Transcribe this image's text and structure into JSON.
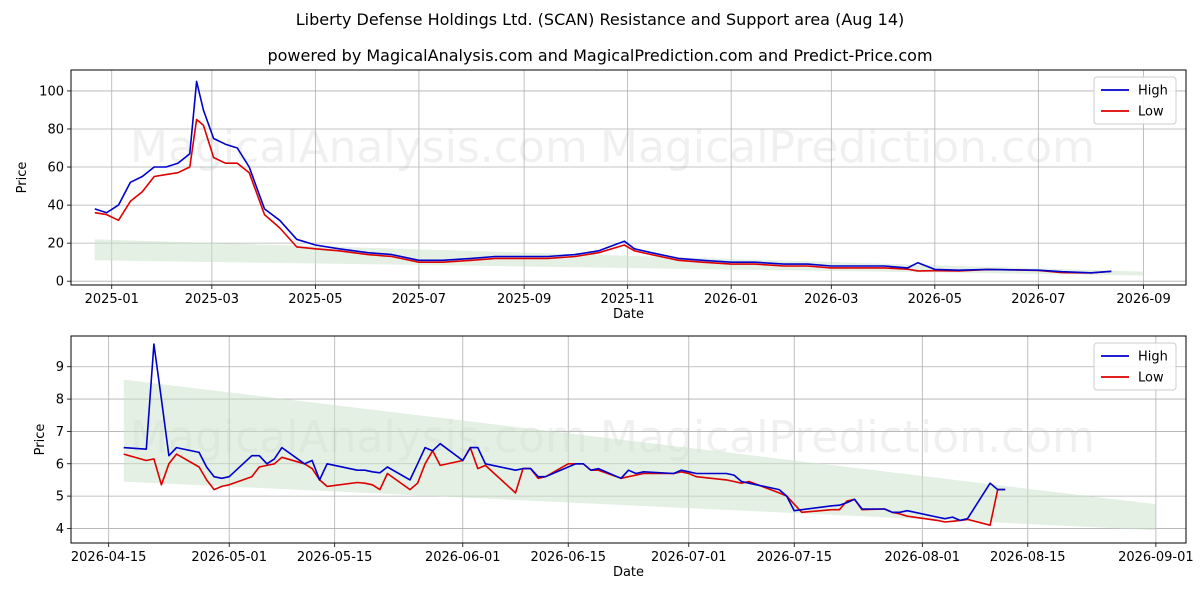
{
  "header": {
    "title": "Liberty Defense Holdings Ltd. (SCAN) Resistance and Support area (Aug 14)",
    "subtitle": "powered by MagicalAnalysis.com and MagicalPrediction.com and Predict-Price.com"
  },
  "watermarks": [
    "MagicalAnalysis.com",
    "MagicalPrediction.com"
  ],
  "colors": {
    "high": "#0000cc",
    "low": "#dd0000",
    "band": "#c8e2c8"
  },
  "chart_data": [
    {
      "type": "line",
      "xlabel": "Date",
      "ylabel": "Price",
      "xlim": [
        "2024-12-08",
        "2026-09-26"
      ],
      "ylim": [
        -2,
        111
      ],
      "x_ticks": [
        "2025-01-01",
        "2025-03-01",
        "2025-05-01",
        "2025-07-01",
        "2025-09-01",
        "2025-11-01",
        "2026-01-01",
        "2026-03-01",
        "2026-05-01",
        "2026-07-01",
        "2026-09-01"
      ],
      "x_tick_labels": [
        "2025-01",
        "2025-03",
        "2025-05",
        "2025-07",
        "2025-09",
        "2025-11",
        "2026-01",
        "2026-03",
        "2026-05",
        "2026-07",
        "2026-09"
      ],
      "y_ticks": [
        0,
        20,
        40,
        60,
        80,
        100
      ],
      "grid": true,
      "legend": "top-right",
      "band": {
        "x": [
          "2024-12-22",
          "2026-09-01"
        ],
        "upper": [
          22,
          5
        ],
        "lower": [
          11,
          3
        ]
      },
      "series": [
        {
          "name": "High",
          "x": [
            "2024-12-22",
            "2024-12-29",
            "2025-01-05",
            "2025-01-12",
            "2025-01-19",
            "2025-01-26",
            "2025-02-02",
            "2025-02-09",
            "2025-02-16",
            "2025-02-20",
            "2025-02-24",
            "2025-03-02",
            "2025-03-09",
            "2025-03-16",
            "2025-03-23",
            "2025-04-01",
            "2025-04-10",
            "2025-04-20",
            "2025-05-01",
            "2025-05-15",
            "2025-06-01",
            "2025-06-15",
            "2025-07-01",
            "2025-07-15",
            "2025-08-01",
            "2025-08-15",
            "2025-09-01",
            "2025-09-15",
            "2025-10-01",
            "2025-10-15",
            "2025-10-30",
            "2025-11-05",
            "2025-11-15",
            "2025-12-01",
            "2025-12-15",
            "2026-01-01",
            "2026-01-15",
            "2026-02-01",
            "2026-02-15",
            "2026-03-01",
            "2026-03-15",
            "2026-04-01",
            "2026-04-15",
            "2026-04-21",
            "2026-05-01",
            "2026-05-15",
            "2026-06-01",
            "2026-06-15",
            "2026-07-01",
            "2026-07-15",
            "2026-08-01",
            "2026-08-13"
          ],
          "values": [
            38,
            36,
            40,
            52,
            55,
            60,
            60,
            62,
            67,
            105,
            90,
            75,
            72,
            70,
            60,
            38,
            32,
            22,
            19,
            17,
            15,
            14,
            11,
            11,
            12,
            13,
            13,
            13,
            14,
            16,
            21,
            17,
            15,
            12,
            11,
            10,
            10,
            9,
            9,
            8,
            8,
            8,
            7,
            9.7,
            6.2,
            5.8,
            6.2,
            6.0,
            5.8,
            5.0,
            4.4,
            5.2
          ]
        },
        {
          "name": "Low",
          "x": [
            "2024-12-22",
            "2024-12-29",
            "2025-01-05",
            "2025-01-12",
            "2025-01-19",
            "2025-01-26",
            "2025-02-02",
            "2025-02-09",
            "2025-02-16",
            "2025-02-20",
            "2025-02-24",
            "2025-03-02",
            "2025-03-09",
            "2025-03-16",
            "2025-03-23",
            "2025-04-01",
            "2025-04-10",
            "2025-04-20",
            "2025-05-01",
            "2025-05-15",
            "2025-06-01",
            "2025-06-15",
            "2025-07-01",
            "2025-07-15",
            "2025-08-01",
            "2025-08-15",
            "2025-09-01",
            "2025-09-15",
            "2025-10-01",
            "2025-10-15",
            "2025-10-30",
            "2025-11-05",
            "2025-11-15",
            "2025-12-01",
            "2025-12-15",
            "2026-01-01",
            "2026-01-15",
            "2026-02-01",
            "2026-02-15",
            "2026-03-01",
            "2026-03-15",
            "2026-04-01",
            "2026-04-15",
            "2026-04-21",
            "2026-05-01",
            "2026-05-15",
            "2026-06-01",
            "2026-06-15",
            "2026-07-01",
            "2026-07-15",
            "2026-08-01",
            "2026-08-13"
          ],
          "values": [
            36,
            35,
            32,
            42,
            47,
            55,
            56,
            57,
            60,
            85,
            82,
            65,
            62,
            62,
            57,
            35,
            28,
            18,
            17,
            16,
            14,
            13,
            10,
            10,
            11,
            12,
            12,
            12,
            13,
            15,
            19,
            16,
            14,
            11,
            10,
            9,
            9,
            8,
            8,
            7,
            7,
            7,
            6.3,
            5.4,
            5.5,
            5.4,
            6.1,
            6.0,
            5.6,
            4.5,
            4.3,
            5.2
          ]
        }
      ]
    },
    {
      "type": "line",
      "xlabel": "Date",
      "ylabel": "Price",
      "xlim": [
        "2026-04-10",
        "2026-09-05"
      ],
      "ylim": [
        3.55,
        9.95
      ],
      "x_ticks": [
        "2026-04-15",
        "2026-05-01",
        "2026-05-15",
        "2026-06-01",
        "2026-06-15",
        "2026-07-01",
        "2026-07-15",
        "2026-08-01",
        "2026-08-15",
        "2026-09-01"
      ],
      "x_tick_labels": [
        "2026-04-15",
        "2026-05-01",
        "2026-05-15",
        "2026-06-01",
        "2026-06-15",
        "2026-07-01",
        "2026-07-15",
        "2026-08-01",
        "2026-08-15",
        "2026-09-01"
      ],
      "y_ticks": [
        4,
        5,
        6,
        7,
        8,
        9
      ],
      "grid": true,
      "legend": "top-right",
      "band": {
        "x": [
          "2026-04-17",
          "2026-09-01"
        ],
        "upper": [
          8.6,
          4.75
        ],
        "lower": [
          5.45,
          3.95
        ]
      },
      "series": [
        {
          "name": "High",
          "x": [
            "2026-04-17",
            "2026-04-20",
            "2026-04-21",
            "2026-04-22",
            "2026-04-23",
            "2026-04-24",
            "2026-04-27",
            "2026-04-28",
            "2026-04-29",
            "2026-04-30",
            "2026-05-01",
            "2026-05-04",
            "2026-05-05",
            "2026-05-06",
            "2026-05-07",
            "2026-05-08",
            "2026-05-11",
            "2026-05-12",
            "2026-05-13",
            "2026-05-14",
            "2026-05-18",
            "2026-05-19",
            "2026-05-20",
            "2026-05-21",
            "2026-05-22",
            "2026-05-25",
            "2026-05-26",
            "2026-05-27",
            "2026-05-28",
            "2026-05-29",
            "2026-06-01",
            "2026-06-02",
            "2026-06-03",
            "2026-06-04",
            "2026-06-08",
            "2026-06-09",
            "2026-06-10",
            "2026-06-11",
            "2026-06-12",
            "2026-06-15",
            "2026-06-16",
            "2026-06-17",
            "2026-06-18",
            "2026-06-19",
            "2026-06-22",
            "2026-06-23",
            "2026-06-24",
            "2026-06-25",
            "2026-06-29",
            "2026-06-30",
            "2026-07-01",
            "2026-07-02",
            "2026-07-06",
            "2026-07-07",
            "2026-07-08",
            "2026-07-09",
            "2026-07-13",
            "2026-07-14",
            "2026-07-15",
            "2026-07-16",
            "2026-07-20",
            "2026-07-21",
            "2026-07-22",
            "2026-07-23",
            "2026-07-24",
            "2026-07-27",
            "2026-07-28",
            "2026-07-29",
            "2026-07-30",
            "2026-08-03",
            "2026-08-04",
            "2026-08-05",
            "2026-08-06",
            "2026-08-07",
            "2026-08-10",
            "2026-08-11",
            "2026-08-12"
          ],
          "values": [
            6.5,
            6.45,
            9.7,
            8.0,
            6.25,
            6.5,
            6.35,
            5.9,
            5.6,
            5.55,
            5.6,
            6.25,
            6.25,
            6.0,
            6.15,
            6.5,
            6.0,
            6.1,
            5.5,
            6.0,
            5.8,
            5.8,
            5.75,
            5.72,
            5.9,
            5.5,
            6.0,
            6.5,
            6.4,
            6.62,
            6.1,
            6.5,
            6.5,
            6.0,
            5.8,
            5.85,
            5.85,
            5.6,
            5.6,
            5.9,
            6.0,
            6.0,
            5.8,
            5.85,
            5.55,
            5.8,
            5.7,
            5.75,
            5.7,
            5.8,
            5.75,
            5.7,
            5.7,
            5.65,
            5.45,
            5.4,
            5.2,
            5.0,
            4.55,
            4.58,
            4.7,
            4.72,
            4.8,
            4.9,
            4.6,
            4.6,
            4.5,
            4.5,
            4.55,
            4.35,
            4.3,
            4.35,
            4.25,
            4.3,
            5.4,
            5.2,
            5.2
          ]
        },
        {
          "name": "Low",
          "x": [
            "2026-04-17",
            "2026-04-20",
            "2026-04-21",
            "2026-04-22",
            "2026-04-23",
            "2026-04-24",
            "2026-04-27",
            "2026-04-28",
            "2026-04-29",
            "2026-04-30",
            "2026-05-01",
            "2026-05-04",
            "2026-05-05",
            "2026-05-06",
            "2026-05-07",
            "2026-05-08",
            "2026-05-11",
            "2026-05-12",
            "2026-05-13",
            "2026-05-14",
            "2026-05-18",
            "2026-05-19",
            "2026-05-20",
            "2026-05-21",
            "2026-05-22",
            "2026-05-25",
            "2026-05-26",
            "2026-05-27",
            "2026-05-28",
            "2026-05-29",
            "2026-06-01",
            "2026-06-02",
            "2026-06-03",
            "2026-06-04",
            "2026-06-08",
            "2026-06-09",
            "2026-06-10",
            "2026-06-11",
            "2026-06-12",
            "2026-06-15",
            "2026-06-16",
            "2026-06-17",
            "2026-06-18",
            "2026-06-19",
            "2026-06-22",
            "2026-06-23",
            "2026-06-24",
            "2026-06-25",
            "2026-06-29",
            "2026-06-30",
            "2026-07-01",
            "2026-07-02",
            "2026-07-06",
            "2026-07-07",
            "2026-07-08",
            "2026-07-09",
            "2026-07-13",
            "2026-07-14",
            "2026-07-15",
            "2026-07-16",
            "2026-07-20",
            "2026-07-21",
            "2026-07-22",
            "2026-07-23",
            "2026-07-24",
            "2026-07-27",
            "2026-07-28",
            "2026-07-29",
            "2026-07-30",
            "2026-08-03",
            "2026-08-04",
            "2026-08-05",
            "2026-08-06",
            "2026-08-07",
            "2026-08-10",
            "2026-08-11",
            "2026-08-12"
          ],
          "values": [
            6.3,
            6.1,
            6.15,
            5.35,
            6.0,
            6.3,
            5.9,
            5.5,
            5.2,
            5.3,
            5.35,
            5.6,
            5.9,
            5.95,
            6.0,
            6.2,
            6.0,
            5.85,
            5.5,
            5.3,
            5.42,
            5.4,
            5.35,
            5.2,
            5.7,
            5.2,
            5.4,
            6.0,
            6.4,
            5.95,
            6.1,
            6.5,
            5.85,
            5.95,
            5.1,
            5.85,
            5.85,
            5.55,
            5.6,
            6.0,
            6.0,
            6.0,
            5.8,
            5.8,
            5.55,
            5.6,
            5.65,
            5.7,
            5.7,
            5.75,
            5.7,
            5.6,
            5.5,
            5.45,
            5.4,
            5.45,
            5.1,
            5.0,
            4.75,
            4.5,
            4.58,
            4.58,
            4.85,
            4.9,
            4.58,
            4.6,
            4.5,
            4.45,
            4.38,
            4.25,
            4.2,
            4.22,
            4.25,
            4.28,
            4.1,
            5.2,
            5.2
          ]
        }
      ]
    }
  ]
}
